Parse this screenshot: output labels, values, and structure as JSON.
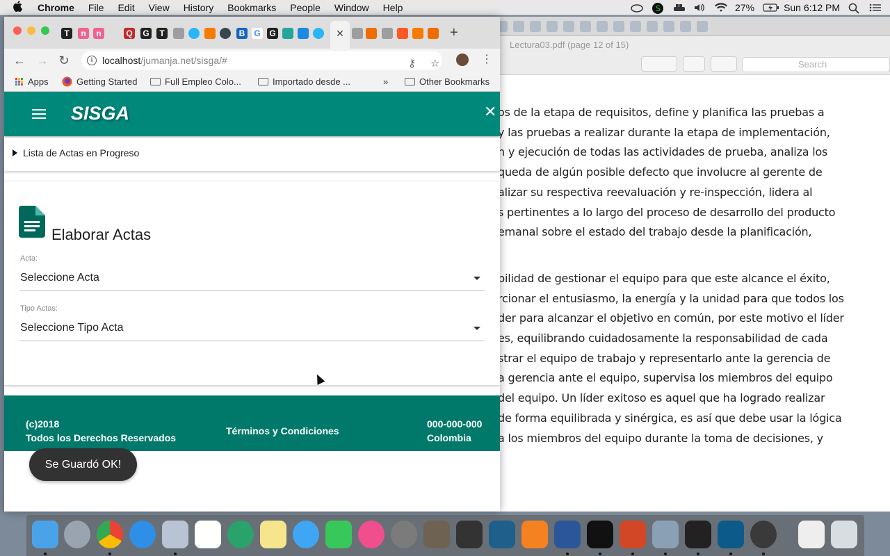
{
  "menubar": {
    "apple": "",
    "app_name": "Chrome",
    "items": [
      "File",
      "Edit",
      "View",
      "History",
      "Bookmarks",
      "People",
      "Window",
      "Help"
    ],
    "battery": "27%",
    "clock": "Sun 6:12 PM"
  },
  "preview_window": {
    "title": "Lectura03.pdf (page 12 of 15)",
    "search_placeholder": "Search",
    "paragraph_1": [
      "os de la etapa de requisitos, define y planifica las pruebas a",
      "y las pruebas a realizar durante la etapa de implementación,",
      "n y ejecución de todas las actividades de prueba, analiza los",
      "queda de algún posible defecto que involucre al gerente de",
      "alizar su respectiva reevaluación y re-inspección, lidera al",
      "s pertinentes a lo largo del proceso de desarrollo del producto",
      "emanal sobre el estado del trabajo desde la planificación,"
    ],
    "paragraph_2": [
      "bilidad de gestionar el equipo para que este alcance el éxito,",
      "rcionar el entusiasmo, la energía y la unidad para que todos los",
      "der para alcanzar el objetivo en común, por este motivo el líder",
      "es, equilibrando cuidadosamente la responsabilidad de cada",
      "strar el equipo de trabajo y representarlo ante la gerencia de",
      "a gerencia ante el equipo, supervisa los miembros del equipo",
      " del equipo. Un líder exitoso es aquel que ha logrado realizar",
      "de forma equilibrada y sinérgica, es así que debe usar la lógica",
      "a los miembros del equipo durante la toma de decisiones, y"
    ]
  },
  "browser": {
    "url_host": "localhost",
    "url_path": "/jumanja.net/sisga/#",
    "bookmarks": {
      "apps": "Apps",
      "getting_started": "Getting Started",
      "folder1": "Full Empleo Colo...",
      "folder2": "Importado desde ...",
      "more": "»",
      "other": "Other Bookmarks"
    }
  },
  "app": {
    "brand": "SISGA",
    "collapsible_label": "Lista de Actas en Progreso",
    "card_title": "Elaborar Actas",
    "acta_label": "Acta:",
    "acta_value": "Seleccione Acta",
    "tipo_label": "Tipo Actas:",
    "tipo_value": "Seleccione Tipo Acta",
    "footer": {
      "copyright": "(c)2018",
      "rights": "Todos los Derechos Reservados",
      "terms": "Términos y Condiciones",
      "phone": "000-000-000",
      "country": "Colombia"
    },
    "toast": "Se Guardó OK!"
  }
}
